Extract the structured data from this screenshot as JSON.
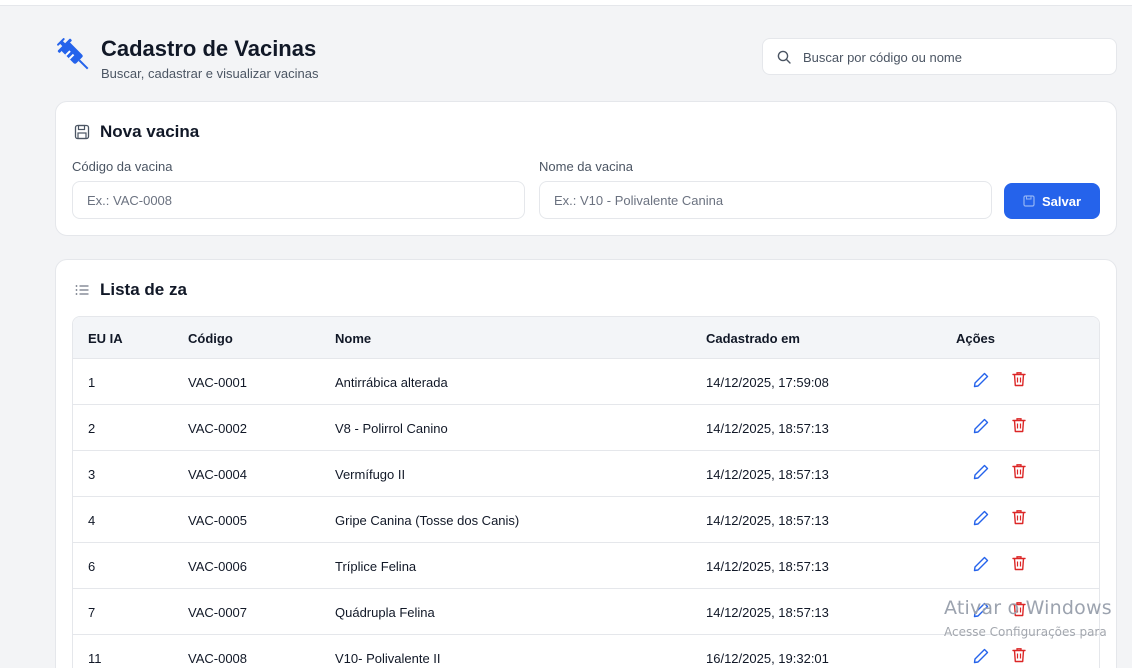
{
  "header": {
    "title": "Cadastro de Vacinas",
    "subtitle": "Buscar, cadastrar e visualizar vacinas",
    "search_placeholder": "Buscar por código ou nome",
    "logo_icon": "syringe-icon"
  },
  "form": {
    "title": "Nova vacina",
    "code_label": "Código da vacina",
    "code_placeholder": "Ex.: VAC-0008",
    "name_label": "Nome da vacina",
    "name_placeholder": "Ex.: V10 - Polivalente Canina",
    "save_label": "Salvar"
  },
  "list": {
    "title": "Lista de za",
    "columns": [
      "EU IA",
      "Código",
      "Nome",
      "Cadastrado em",
      "Ações"
    ],
    "rows": [
      {
        "id": "1",
        "code": "VAC-0001",
        "name": "Antirrábica alterada",
        "date": "14/12/2025, 17:59:08"
      },
      {
        "id": "2",
        "code": "VAC-0002",
        "name": "V8 - Polirrol Canino",
        "date": "14/12/2025, 18:57:13"
      },
      {
        "id": "3",
        "code": "VAC-0004",
        "name": "Vermífugo II",
        "date": "14/12/2025, 18:57:13"
      },
      {
        "id": "4",
        "code": "VAC-0005",
        "name": "Gripe Canina (Tosse dos Canis)",
        "date": "14/12/2025, 18:57:13"
      },
      {
        "id": "6",
        "code": "VAC-0006",
        "name": "Tríplice Felina",
        "date": "14/12/2025, 18:57:13"
      },
      {
        "id": "7",
        "code": "VAC-0007",
        "name": "Quádrupla Felina",
        "date": "14/12/2025, 18:57:13"
      },
      {
        "id": "11",
        "code": "VAC-0008",
        "name": "V10- Polivalente II",
        "date": "16/12/2025, 19:32:01"
      }
    ]
  },
  "watermark": {
    "line1": "Ativar o Windows",
    "line2": "Acesse Configurações para"
  },
  "colors": {
    "accent": "#2563eb",
    "edit_icon": "#2563eb",
    "delete_icon": "#dc2626"
  }
}
